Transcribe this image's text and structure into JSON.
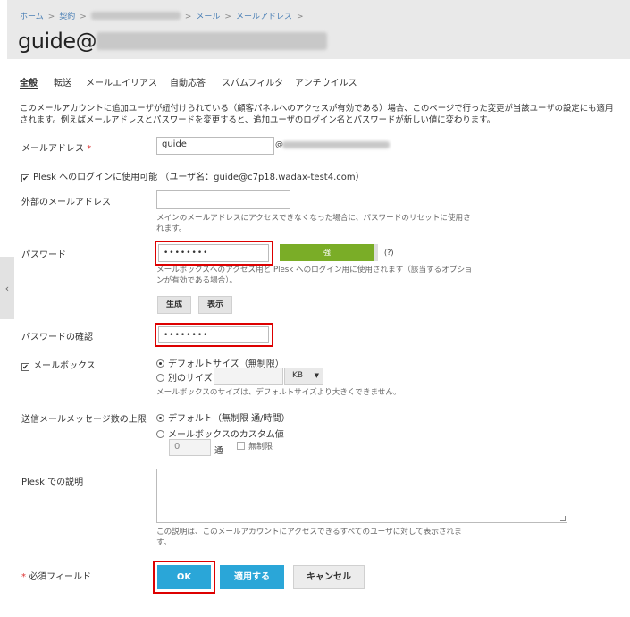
{
  "breadcrumb": {
    "home": "ホーム",
    "contracts": "契約",
    "mail": "メール",
    "mail_address": "メールアドレス",
    "sep": ">"
  },
  "page": {
    "title_visible": "guide@"
  },
  "tabs": [
    {
      "label": "全般",
      "active": true
    },
    {
      "label": "転送"
    },
    {
      "label": "メールエイリアス"
    },
    {
      "label": "自動応答"
    },
    {
      "label": "スパムフィルタ"
    },
    {
      "label": "アンチウイルス"
    }
  ],
  "intro_text": "このメールアカウントに追加ユーザが紐付けられている（顧客パネルへのアクセスが有効である）場合、このページで行った変更が当該ユーザの設定にも適用されます。例えばメールアドレスとパスワードを変更すると、追加ユーザのログイン名とパスワードが新しい値に変わります。",
  "form": {
    "email_label": "メールアドレス",
    "required_mark": "*",
    "email_value": "guide",
    "at_mark": "@",
    "plesk_login_label": "Plesk へのログインに使用可能 （ユーザ名：guide@c7p18.wadax-test4.com）",
    "external_email_label": "外部のメールアドレス",
    "external_email_value": "",
    "external_email_hint": "メインのメールアドレスにアクセスできなくなった場合に、パスワードのリセットに使用されます。",
    "password_label": "パスワード",
    "password_value": "••••••••",
    "strength_label": "強",
    "help_mark": "(?)",
    "password_hint": "メールボックスへのアクセス用と Plesk へのログイン用に使用されます（該当するオプションが有効である場合）。",
    "generate_button": "生成",
    "show_button": "表示",
    "confirm_label": "パスワードの確認",
    "confirm_value": "••••••••",
    "mailbox_label": "メールボックス",
    "mailbox_default": "デフォルトサイズ（無制限）",
    "mailbox_custom": "別のサイズ",
    "mailbox_unit": "KB",
    "mailbox_hint": "メールボックスのサイズは、デフォルトサイズより大きくできません。",
    "outgoing_label": "送信メールメッセージ数の上限",
    "outgoing_default": "デフォルト（無制限 通/時間）",
    "outgoing_custom": "メールボックスのカスタム値",
    "outgoing_value": "0",
    "outgoing_unit": "通",
    "unlimited_label": "無制限",
    "description_label": "Plesk での説明",
    "description_hint": "この説明は、このメールアカウントにアクセスできるすべてのユーザに対して表示されます。",
    "required_fields": "必須フィールド"
  },
  "actions": {
    "ok": "OK",
    "apply": "適用する",
    "cancel": "キャンセル"
  },
  "colors": {
    "primary": "#2aa6d8",
    "strength": "#7aad27",
    "highlight": "#dd0000",
    "link": "#4a7fb5"
  }
}
